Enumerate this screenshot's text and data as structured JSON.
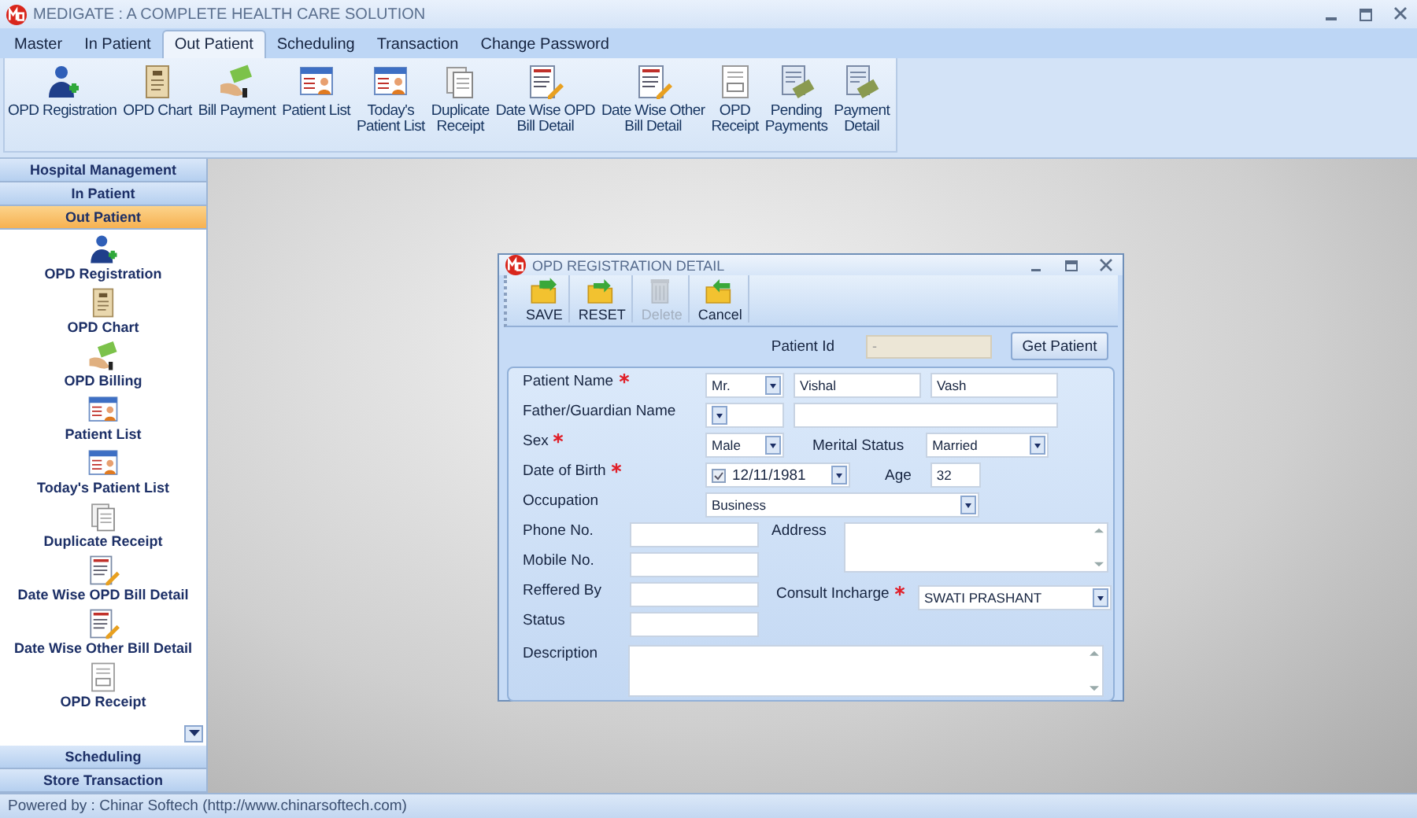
{
  "app": {
    "title": "MEDIGATE : A COMPLETE HEALTH CARE SOLUTION"
  },
  "menu_tabs": [
    {
      "label": "Master",
      "selected": false
    },
    {
      "label": "In Patient",
      "selected": false
    },
    {
      "label": "Out Patient",
      "selected": true
    },
    {
      "label": "Scheduling",
      "selected": false
    },
    {
      "label": "Transaction",
      "selected": false
    },
    {
      "label": "Change Password",
      "selected": false
    }
  ],
  "ribbon": [
    {
      "label": "OPD Registration",
      "kind": "person-add"
    },
    {
      "label": "OPD Chart",
      "kind": "chart"
    },
    {
      "label": "Bill Payment",
      "kind": "money"
    },
    {
      "label": "Patient List",
      "kind": "list"
    },
    {
      "label": "Today's\nPatient List",
      "kind": "list"
    },
    {
      "label": "Duplicate\nReceipt",
      "kind": "document"
    },
    {
      "label": "Date Wise OPD\nBill Detail",
      "kind": "bill"
    },
    {
      "label": "Date Wise Other\nBill Detail",
      "kind": "bill"
    },
    {
      "label": "OPD\nReceipt",
      "kind": "receipt"
    },
    {
      "label": "Pending\nPayments",
      "kind": "payment"
    },
    {
      "label": "Payment\nDetail",
      "kind": "payment"
    }
  ],
  "sidebar_groups": [
    {
      "label": "Hospital Management",
      "selected": false
    },
    {
      "label": "In Patient",
      "selected": false
    },
    {
      "label": "Out Patient",
      "selected": true,
      "items": [
        {
          "label": "OPD Registration",
          "kind": "person-add"
        },
        {
          "label": "OPD Chart",
          "kind": "chart"
        },
        {
          "label": "OPD Billing",
          "kind": "money"
        },
        {
          "label": "Patient List",
          "kind": "list"
        },
        {
          "label": "Today's Patient List",
          "kind": "list"
        },
        {
          "label": "Duplicate Receipt",
          "kind": "document"
        },
        {
          "label": "Date Wise OPD Bill Detail",
          "kind": "bill"
        },
        {
          "label": "Date Wise Other Bill Detail",
          "kind": "bill"
        },
        {
          "label": "OPD Receipt",
          "kind": "receipt"
        }
      ]
    },
    {
      "label": "Scheduling",
      "selected": false
    },
    {
      "label": "Store Transaction",
      "selected": false
    }
  ],
  "dialog": {
    "title": "OPD REGISTRATION DETAIL",
    "toolbar": [
      {
        "label": "SAVE",
        "kind": "save",
        "disabled": false
      },
      {
        "label": "RESET",
        "kind": "reset",
        "disabled": false
      },
      {
        "label": "Delete",
        "kind": "delete",
        "disabled": true
      },
      {
        "label": "Cancel",
        "kind": "cancel",
        "disabled": false
      }
    ],
    "patient_id": {
      "label": "Patient Id",
      "placeholder": "-"
    },
    "get_patient_button": "Get Patient",
    "form": {
      "patient_name": {
        "label": "Patient Name",
        "required": true,
        "salutation": "Mr.",
        "first_name": "Vishal",
        "last_name": "Vash"
      },
      "father_guardian_name": {
        "label": "Father/Guardian Name"
      },
      "sex": {
        "label": "Sex",
        "required": true,
        "value": "Male"
      },
      "marital_status": {
        "label": "Merital Status",
        "value": "Married"
      },
      "date_of_birth": {
        "label": "Date of Birth",
        "required": true,
        "checked": true,
        "value": "12/11/1981"
      },
      "age": {
        "label": "Age",
        "value": "32"
      },
      "occupation": {
        "label": "Occupation",
        "value": "Business"
      },
      "phone": {
        "label": "Phone No."
      },
      "mobile": {
        "label": "Mobile No."
      },
      "referred_by": {
        "label": "Reffered By"
      },
      "status": {
        "label": "Status"
      },
      "address": {
        "label": "Address"
      },
      "consult_incharge": {
        "label": "Consult Incharge",
        "required": true,
        "value": "SWATI PRASHANT"
      },
      "description": {
        "label": "Description"
      }
    }
  },
  "status_bar": "Powered by : Chinar Softech (http://www.chinarsoftech.com)"
}
